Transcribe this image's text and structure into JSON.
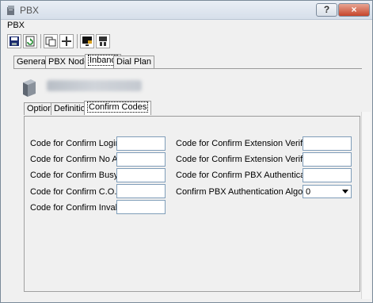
{
  "window": {
    "title": "PBX"
  },
  "titlebar": {
    "help_label": "?",
    "close_label": "×"
  },
  "menu": {
    "item": "PBX"
  },
  "toolbar": {
    "icons": [
      "save-icon",
      "refresh-icon",
      "copy-icon",
      "add-icon",
      "monitor-icon",
      "settings-icon"
    ]
  },
  "main_tabs": [
    {
      "label": "General"
    },
    {
      "label": "PBX Node"
    },
    {
      "label": "Inband"
    },
    {
      "label": "Dial Plan"
    }
  ],
  "sub_tabs": [
    {
      "label": "Options"
    },
    {
      "label": "Definition"
    },
    {
      "label": "Confirm Codes"
    }
  ],
  "left_fields": [
    {
      "label": "Code for Confirm Login",
      "value": ""
    },
    {
      "label": "Code for Confirm No Answer",
      "value": ""
    },
    {
      "label": "Code for Confirm Busy",
      "value": ""
    },
    {
      "label": "Code for Confirm C.O. Call",
      "value": ""
    },
    {
      "label": "Code for Confirm Invalid",
      "value": ""
    }
  ],
  "right_fields": [
    {
      "label": "Code for Confirm Extension Verify (Valid)",
      "value": ""
    },
    {
      "label": "Code for Confirm Extension Verify (Invalid)",
      "value": ""
    },
    {
      "label": "Code for Confirm PBX Authentication",
      "value": ""
    }
  ],
  "algorithm": {
    "label": "Confirm PBX Authentication Algorithm",
    "value": "0"
  }
}
